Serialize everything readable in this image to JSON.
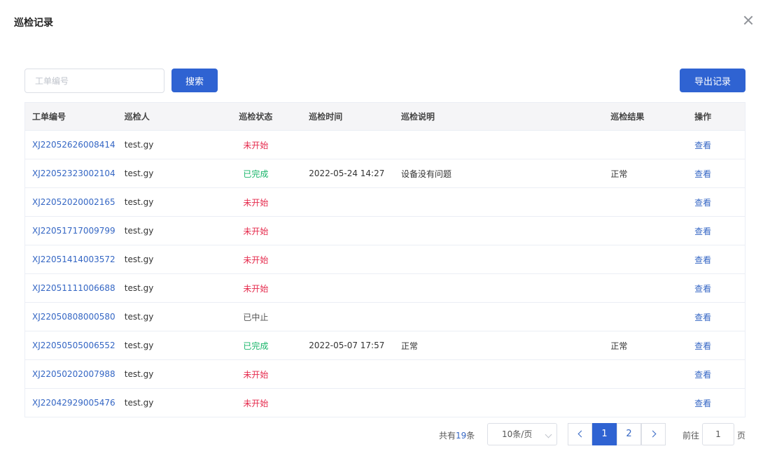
{
  "dialog": {
    "title": "巡检记录"
  },
  "search": {
    "placeholder": "工单编号",
    "value": "",
    "button": "搜索"
  },
  "export_button": "导出记录",
  "table": {
    "headers": [
      "工单编号",
      "巡检人",
      "巡检状态",
      "巡检时间",
      "巡检说明",
      "巡检结果",
      "操作"
    ],
    "rows": [
      {
        "id": "XJ22052626008414",
        "inspector": "test.gy",
        "status": "未开始",
        "status_color": "#e52b4d",
        "time": "",
        "desc": "",
        "result": "",
        "action": "查看"
      },
      {
        "id": "XJ22052323002104",
        "inspector": "test.gy",
        "status": "已完成",
        "status_color": "#18b56a",
        "time": "2022-05-24 14:27",
        "desc": "设备没有问题",
        "result": "正常",
        "action": "查看"
      },
      {
        "id": "XJ22052020002165",
        "inspector": "test.gy",
        "status": "未开始",
        "status_color": "#e52b4d",
        "time": "",
        "desc": "",
        "result": "",
        "action": "查看"
      },
      {
        "id": "XJ22051717009799",
        "inspector": "test.gy",
        "status": "未开始",
        "status_color": "#e52b4d",
        "time": "",
        "desc": "",
        "result": "",
        "action": "查看"
      },
      {
        "id": "XJ22051414003572",
        "inspector": "test.gy",
        "status": "未开始",
        "status_color": "#e52b4d",
        "time": "",
        "desc": "",
        "result": "",
        "action": "查看"
      },
      {
        "id": "XJ22051111006688",
        "inspector": "test.gy",
        "status": "未开始",
        "status_color": "#e52b4d",
        "time": "",
        "desc": "",
        "result": "",
        "action": "查看"
      },
      {
        "id": "XJ22050808000580",
        "inspector": "test.gy",
        "status": "已中止",
        "status_color": "#555555",
        "time": "",
        "desc": "",
        "result": "",
        "action": "查看"
      },
      {
        "id": "XJ22050505006552",
        "inspector": "test.gy",
        "status": "已完成",
        "status_color": "#18b56a",
        "time": "2022-05-07 17:57",
        "desc": "正常",
        "result": "正常",
        "action": "查看"
      },
      {
        "id": "XJ22050202007988",
        "inspector": "test.gy",
        "status": "未开始",
        "status_color": "#e52b4d",
        "time": "",
        "desc": "",
        "result": "",
        "action": "查看"
      },
      {
        "id": "XJ22042929005476",
        "inspector": "test.gy",
        "status": "未开始",
        "status_color": "#e52b4d",
        "time": "",
        "desc": "",
        "result": "",
        "action": "查看"
      }
    ]
  },
  "pagination": {
    "total_prefix": "共有",
    "total": "19",
    "total_suffix": "条",
    "page_size": "10条/页",
    "pages": [
      "1",
      "2"
    ],
    "current_page": "1",
    "goto_label": "前往",
    "goto_value": "1",
    "goto_suffix": "页"
  },
  "icons": {
    "close": "close-icon",
    "prev": "chevron-left-icon",
    "next": "chevron-right-icon",
    "select": "chevron-down-icon"
  },
  "colors": {
    "primary": "#2f63d2",
    "link": "#3466c4",
    "not_started": "#e52b4d",
    "completed": "#18b56a"
  }
}
